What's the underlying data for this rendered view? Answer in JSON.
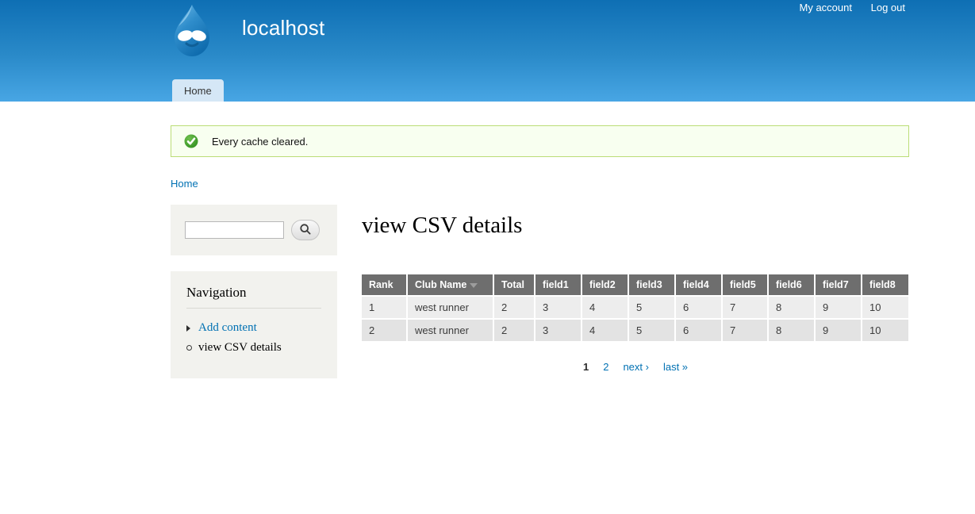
{
  "header": {
    "site_name": "localhost",
    "links": [
      {
        "label": "My account"
      },
      {
        "label": "Log out"
      }
    ],
    "tabs": [
      {
        "label": "Home"
      }
    ]
  },
  "status_message": {
    "icon": "status-check-icon",
    "text": "Every cache cleared."
  },
  "breadcrumb": {
    "items": [
      {
        "label": "Home"
      }
    ]
  },
  "sidebar": {
    "search": {
      "value": "",
      "placeholder": "",
      "button_icon": "search-icon"
    },
    "navigation": {
      "title": "Navigation",
      "items": [
        {
          "label": "Add content",
          "type": "link",
          "bullet": "menu-collapsed-icon"
        },
        {
          "label": "view CSV details",
          "type": "active",
          "bullet": "menu-leaf-icon"
        }
      ]
    }
  },
  "main": {
    "page_title": "view CSV details",
    "table": {
      "columns": [
        {
          "label": "Rank"
        },
        {
          "label": "Club Name",
          "sort": "desc",
          "sort_icon": "sort-desc-arrow-icon"
        },
        {
          "label": "Total"
        },
        {
          "label": "field1"
        },
        {
          "label": "field2"
        },
        {
          "label": "field3"
        },
        {
          "label": "field4"
        },
        {
          "label": "field5"
        },
        {
          "label": "field6"
        },
        {
          "label": "field7"
        },
        {
          "label": "field8"
        }
      ],
      "rows": [
        [
          "1",
          "west runner",
          "2",
          "3",
          "4",
          "5",
          "6",
          "7",
          "8",
          "9",
          "10"
        ],
        [
          "2",
          "west runner",
          "2",
          "3",
          "4",
          "5",
          "6",
          "7",
          "8",
          "9",
          "10"
        ]
      ]
    },
    "pager": {
      "items": [
        {
          "label": "1",
          "type": "current"
        },
        {
          "label": "2",
          "type": "page"
        },
        {
          "label": "next ›",
          "type": "next"
        },
        {
          "label": "last »",
          "type": "last"
        }
      ]
    }
  },
  "colors": {
    "link": "#0071b3",
    "header_gradient_top": "#0e6fb4",
    "header_gradient_bottom": "#48a6e4",
    "tab_bg": "#d5e7f6",
    "status_bg": "#f8fff0",
    "status_border": "#bbdd77",
    "sidebar_block_bg": "#f2f2ee",
    "table_header_bg": "#6e6e6e",
    "table_row_odd": "#ededed",
    "table_row_even": "#e3e3e3"
  }
}
